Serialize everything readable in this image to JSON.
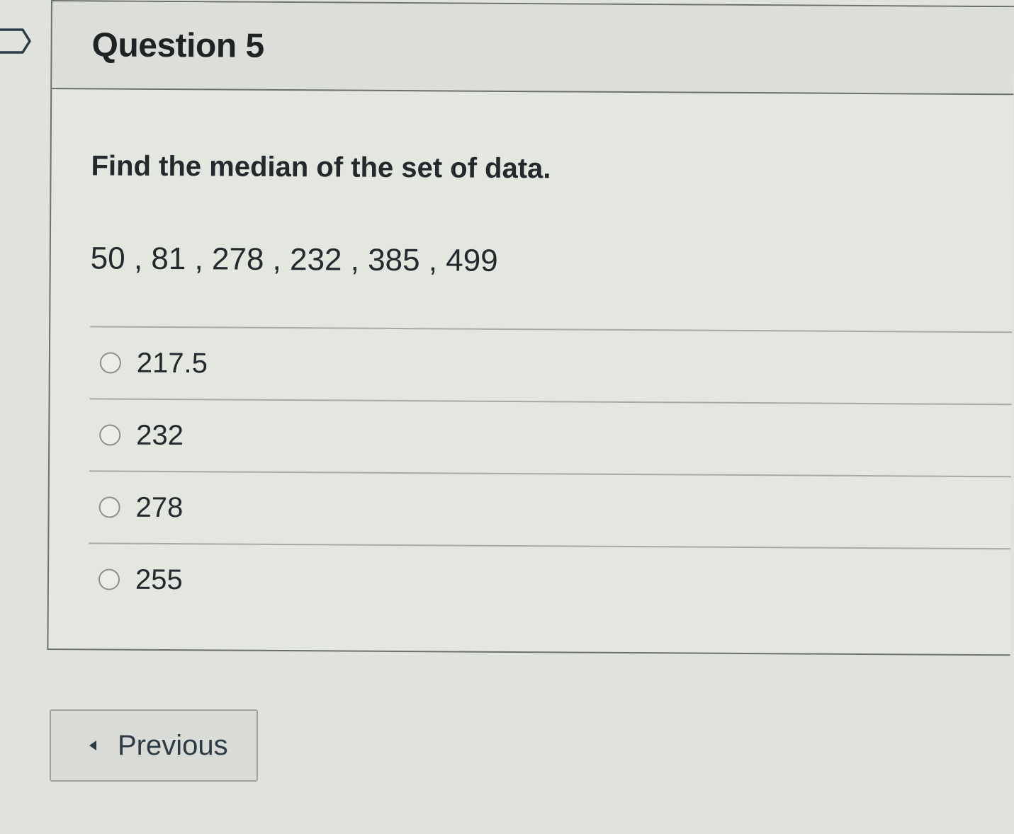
{
  "question": {
    "title": "Question 5",
    "prompt": "Find the median of the set of data.",
    "data_set": "50 , 81 , 278 , 232 , 385 , 499",
    "answers": [
      {
        "label": "217.5",
        "selected": false
      },
      {
        "label": "232",
        "selected": false
      },
      {
        "label": "278",
        "selected": false
      },
      {
        "label": "255",
        "selected": false
      }
    ]
  },
  "navigation": {
    "previous_label": "Previous",
    "previous_icon": "caret-left-icon"
  },
  "icons": {
    "flag": "flag-icon"
  },
  "colors": {
    "text": "#2d3b45",
    "border": "#6c7170"
  }
}
